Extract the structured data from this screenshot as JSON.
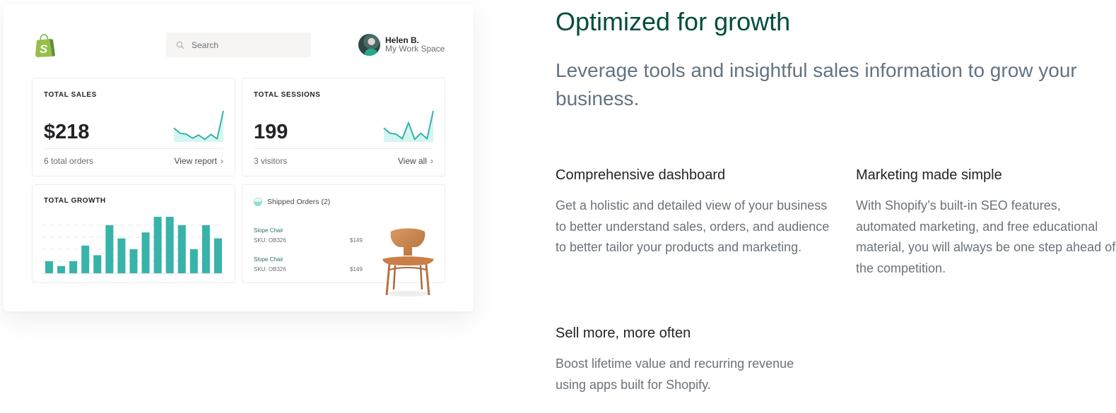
{
  "dashboard": {
    "logo": "shopify-bag-logo",
    "search": {
      "placeholder": "Search",
      "icon": "search-icon"
    },
    "user": {
      "name": "Helen B.",
      "workspace": "My Work Space"
    },
    "accent_color": "#37b3aa",
    "cards": {
      "total_sales": {
        "title": "TOTAL SALES",
        "value": "$218",
        "footer_left": "6 total orders",
        "link_label": "View report",
        "sparkline": [
          0.45,
          0.28,
          0.25,
          0.12,
          0.22,
          0.08,
          0.24,
          0.1,
          1.0
        ]
      },
      "total_sessions": {
        "title": "TOTAL SESSIONS",
        "value": "199",
        "footer_left": "3 visitors",
        "link_label": "View all",
        "sparkline": [
          0.45,
          0.28,
          0.25,
          0.1,
          0.62,
          0.08,
          0.28,
          0.1,
          1.0
        ]
      },
      "total_growth": {
        "title": "TOTAL GROWTH"
      },
      "shipped_orders": {
        "title": "Shipped Orders (2)",
        "orders": [
          {
            "name": "Slope Chair",
            "sku": "SKU: OB326",
            "price": "$149"
          },
          {
            "name": "Slope Chair",
            "sku": "SKU: OB326",
            "price": "$149"
          }
        ]
      }
    }
  },
  "chart_data": {
    "type": "bar",
    "title": "TOTAL GROWTH",
    "categories": [
      "1",
      "2",
      "3",
      "4",
      "5",
      "6",
      "7",
      "8",
      "9",
      "10",
      "11",
      "12",
      "13",
      "14",
      "15"
    ],
    "values": [
      1.0,
      0.6,
      1.0,
      2.3,
      1.5,
      4.0,
      2.9,
      2.0,
      3.4,
      4.7,
      4.7,
      4.0,
      2.0,
      4.0,
      2.9
    ],
    "xlabel": "",
    "ylabel": "",
    "ylim": [
      0,
      5
    ],
    "grid": true,
    "gridlines": [
      1,
      2,
      3,
      4
    ]
  },
  "content": {
    "heading": "Optimized for growth",
    "lead": "Leverage tools and insightful sales information to grow your business.",
    "features": [
      {
        "title": "Comprehensive dashboard",
        "body": "Get a holistic and detailed view of your business to better understand sales, orders, and audience to better tailor your products and marketing."
      },
      {
        "title": "Marketing made simple",
        "body": "With Shopify’s built-in SEO features, automated marketing, and free educational material, you will always be one step ahead of the competition."
      },
      {
        "title": "Sell more, more often",
        "body": "Boost lifetime value and recurring revenue using apps built for Shopify."
      }
    ]
  }
}
